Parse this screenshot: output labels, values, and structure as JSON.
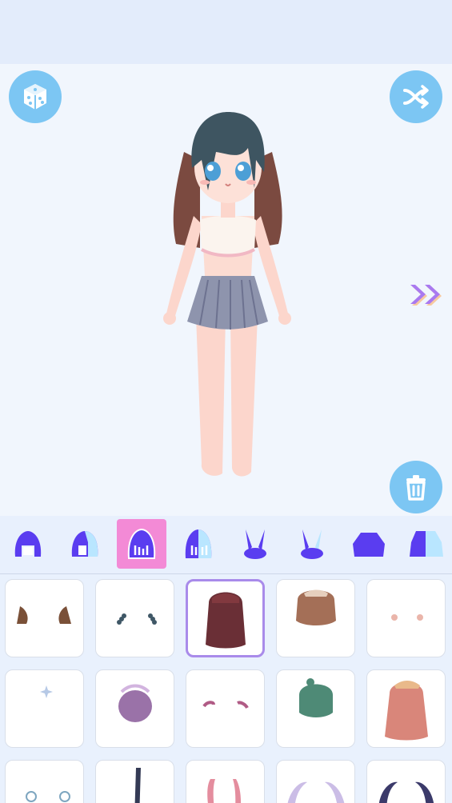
{
  "screen": {
    "title": "",
    "accent_color": "#7cc6f3",
    "selected_tab_color": "#f38ad6",
    "selected_item_color": "#a98bea"
  },
  "toolbar": {
    "random_icon": "dice-icon",
    "shuffle_icon": "shuffle-icon",
    "delete_icon": "trash-icon",
    "next_icon": "double-chevron-right-icon"
  },
  "category_tabs": [
    {
      "icon": "hair-front-icon",
      "selected": false
    },
    {
      "icon": "hair-side-icon",
      "selected": false
    },
    {
      "icon": "hair-back-icon",
      "selected": true
    },
    {
      "icon": "hair-long-icon",
      "selected": false
    },
    {
      "icon": "bunny-ears-icon",
      "selected": false
    },
    {
      "icon": "bunny-ears-alt-icon",
      "selected": false
    },
    {
      "icon": "top-icon",
      "selected": false
    },
    {
      "icon": "jacket-icon",
      "selected": false
    }
  ],
  "items": [
    {
      "name": "brown-animal-ears",
      "selected": false
    },
    {
      "name": "dark-hair-clips",
      "selected": false
    },
    {
      "name": "dark-red-long-hair",
      "selected": true
    },
    {
      "name": "brown-short-hair",
      "selected": false
    },
    {
      "name": "pink-hair-pins",
      "selected": false
    },
    {
      "name": "small-blue-sparkle",
      "selected": false
    },
    {
      "name": "purple-bun-hair",
      "selected": false
    },
    {
      "name": "pink-bow-clips",
      "selected": false
    },
    {
      "name": "green-short-hair",
      "selected": false
    },
    {
      "name": "orange-long-hair",
      "selected": false
    },
    {
      "name": "blue-ring-accessories",
      "selected": false
    },
    {
      "name": "dark-braid",
      "selected": false
    },
    {
      "name": "pink-twin-tails",
      "selected": false
    },
    {
      "name": "lavender-horns",
      "selected": false
    },
    {
      "name": "navy-horns",
      "selected": false
    }
  ]
}
